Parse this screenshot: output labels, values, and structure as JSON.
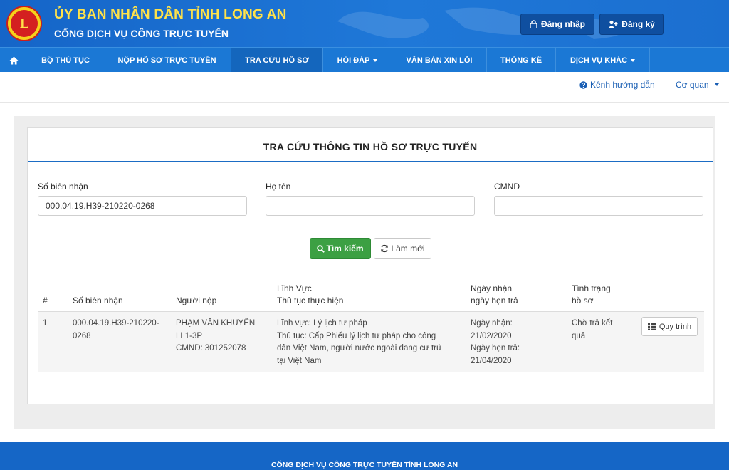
{
  "header": {
    "title": "ỦY BAN NHÂN DÂN TỈNH LONG AN",
    "subtitle": "CỔNG DỊCH VỤ CÔNG TRỰC TUYẾN",
    "logo_text": "L",
    "login_label": "Đăng nhập",
    "register_label": "Đăng ký"
  },
  "nav": {
    "items": [
      {
        "label": "BỘ THỦ TỤC"
      },
      {
        "label": "NỘP HỒ SƠ TRỰC TUYẾN"
      },
      {
        "label": "TRA CỨU HỒ SƠ"
      },
      {
        "label": "HỎI ĐÁP"
      },
      {
        "label": "VĂN BẢN XIN LỖI"
      },
      {
        "label": "THỐNG KÊ"
      },
      {
        "label": "DỊCH VỤ KHÁC"
      }
    ]
  },
  "subbar": {
    "guide_label": "Kênh hướng dẫn",
    "agency_label": "Cơ quan"
  },
  "panel": {
    "title": "TRA CỨU THÔNG TIN HỒ SƠ TRỰC TUYẾN"
  },
  "form": {
    "receipt_label": "Số biên nhận",
    "receipt_value": "000.04.19.H39-210220-0268",
    "name_label": "Họ tên",
    "name_value": "",
    "id_label": "CMND",
    "id_value": "",
    "search_label": "Tìm kiếm",
    "reset_label": "Làm mới"
  },
  "table": {
    "headers": {
      "index": "#",
      "receipt": "Số biên nhận",
      "submitter": "Người nộp",
      "field_line1": "Lĩnh Vực",
      "field_line2": "Thủ tục thực hiện",
      "dates_line1": "Ngày nhận",
      "dates_line2": "ngày hẹn trả",
      "status_line1": "Tình trạng",
      "status_line2": "hồ sơ"
    },
    "rows": [
      {
        "index": "1",
        "receipt_line1": "000.04.19.H39-210220-",
        "receipt_line2": "0268",
        "submitter_line1": "PHẠM VĂN KHUYÊN",
        "submitter_line2": "LL1-3P",
        "submitter_line3": "CMND: 301252078",
        "field_line1": "Lĩnh vực: Lý lịch tư pháp",
        "field_line2": "Thủ tục: Cấp Phiếu lý lịch tư pháp cho công",
        "field_line3": "dân Việt Nam, người nước ngoài đang cư trú",
        "field_line4": "tại Việt Nam",
        "received_label": "Ngày nhận:",
        "received_date": "21/02/2020",
        "due_label": "Ngày hẹn trả:",
        "due_date": "21/04/2020",
        "status_line1": "Chờ trả kết",
        "status_line2": "quả",
        "action_label": "Quy trình"
      }
    ]
  },
  "footer": {
    "text": "CỔNG DỊCH VỤ CÔNG TRỰC TUYẾN TỈNH LONG AN"
  }
}
